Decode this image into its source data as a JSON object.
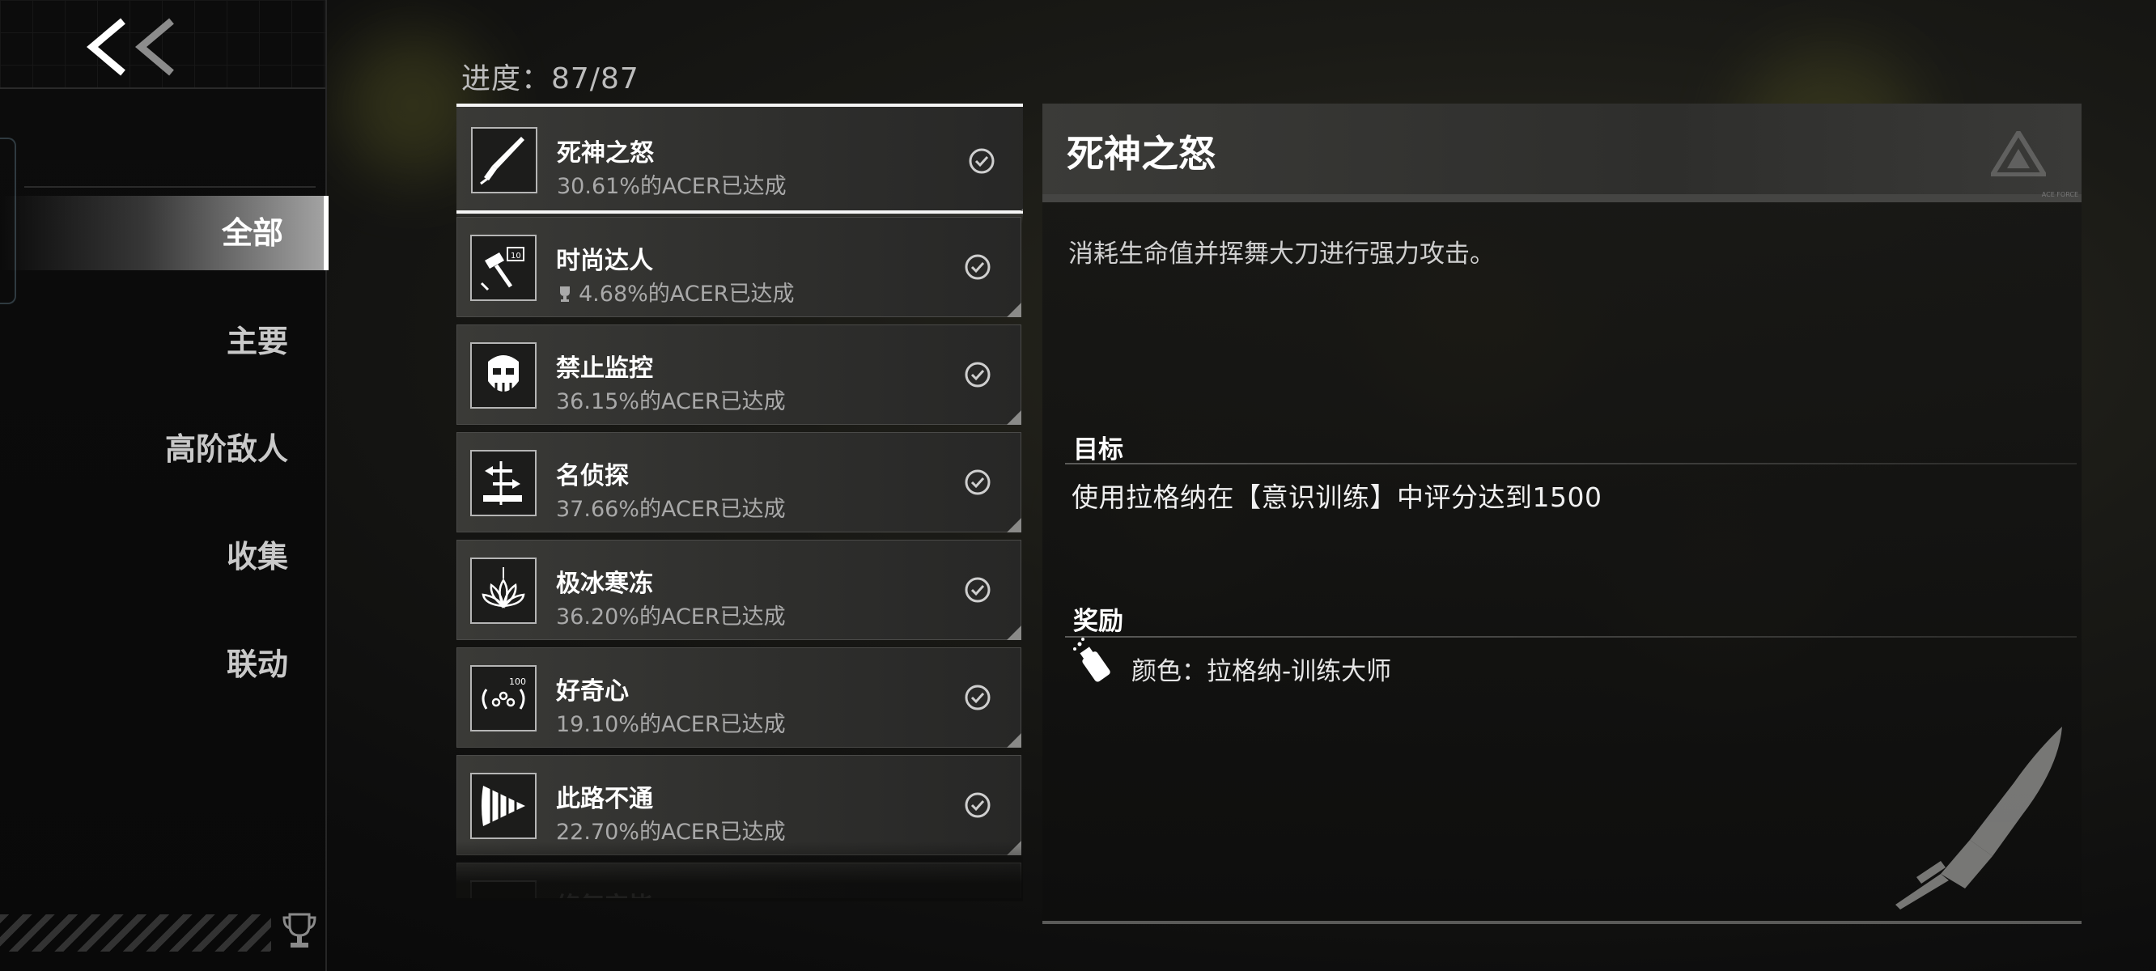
{
  "nav": {
    "items": [
      {
        "label": "全部",
        "active": true
      },
      {
        "label": "主要",
        "active": false
      },
      {
        "label": "高阶敌人",
        "active": false
      },
      {
        "label": "收集",
        "active": false
      },
      {
        "label": "联动",
        "active": false
      }
    ]
  },
  "progress_text": "进度：87/87",
  "achievements": [
    {
      "title": "死神之怒",
      "sub": "30.61%的ACER已达成",
      "icon": "blade-icon",
      "selected": true
    },
    {
      "title": "时尚达人",
      "sub": "4.68%的ACER已达成",
      "icon": "hammer-icon",
      "trophy": true
    },
    {
      "title": "禁止监控",
      "sub": "36.15%的ACER已达成",
      "icon": "mask-icon"
    },
    {
      "title": "名侦探",
      "sub": "37.66%的ACER已达成",
      "icon": "detective-icon"
    },
    {
      "title": "极冰寒冻",
      "sub": "36.20%的ACER已达成",
      "icon": "ice-flower-icon"
    },
    {
      "title": "好奇心",
      "sub": "19.10%的ACER已达成",
      "icon": "curiosity-icon"
    },
    {
      "title": "此路不通",
      "sub": "22.70%的ACER已达成",
      "icon": "drill-icon"
    },
    {
      "title": "修复完毕",
      "sub": "",
      "icon": "partial-icon"
    }
  ],
  "detail": {
    "title": "死神之怒",
    "description": "消耗生命值并挥舞大刀进行强力攻击。",
    "goal_label": "目标",
    "goal_text": "使用拉格纳在【意识训练】中评分达到1500",
    "reward_label": "奖励",
    "reward_text": "颜色：拉格纳-训练大师",
    "header_tiny": "ACE FORCE"
  },
  "colors": {
    "accent": "#ffffff",
    "panel": "#2f2f2d",
    "text_dim": "#a9a9a9"
  }
}
